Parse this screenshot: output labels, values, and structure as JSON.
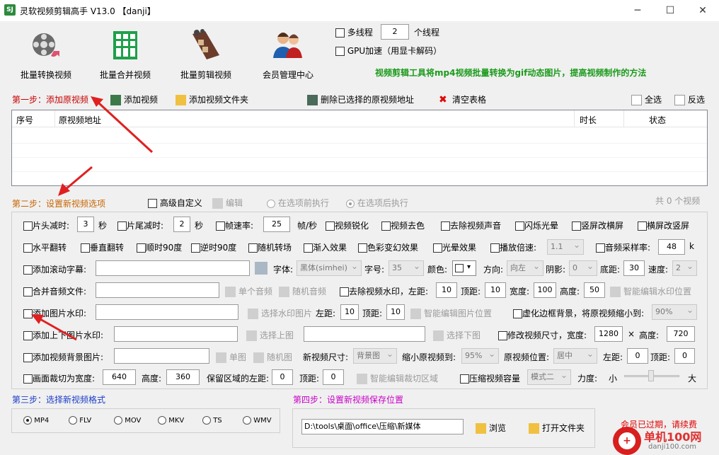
{
  "window": {
    "title": "灵软视频剪辑高手 V13.0 【danji】",
    "app_icon": "app-icon",
    "minimize": "─",
    "maximize": "☐",
    "close": "✕"
  },
  "toolbar": {
    "items": [
      {
        "label": "批量转换视频",
        "icon": "film-reel-icon"
      },
      {
        "label": "批量合并视频",
        "icon": "merge-grid-icon"
      },
      {
        "label": "批量剪辑视频",
        "icon": "film-strip-icon"
      },
      {
        "label": "会员管理中心",
        "icon": "users-icon"
      }
    ]
  },
  "threads": {
    "multithread_label": "多线程",
    "thread_count": "2",
    "thread_unit": "个线程",
    "gpu_label": "GPU加速（用显卡解码）"
  },
  "promo": {
    "text": "视频剪辑工具将mp4视频批量转换为gif动态图片，提高视频制作的方法",
    "color": "#1a9a1a"
  },
  "step1": {
    "title": "第一步：添加原视频",
    "add_video": "添加视频",
    "add_folder": "添加视频文件夹",
    "delete_selected": "删除已选择的原视频地址",
    "clear_table": "清空表格",
    "select_all": "全选",
    "invert": "反选"
  },
  "table": {
    "columns": [
      "序号",
      "原视频地址",
      "时长",
      "状态"
    ]
  },
  "step2": {
    "title": "第二步：设置新视频选项",
    "advanced": "高级自定义",
    "edit": "编辑",
    "before": "在选项前执行",
    "after": "在选项后执行",
    "count_text": "共 0 个视频"
  },
  "row1": {
    "head_cut": "片头减时:",
    "head_val": "3",
    "sec1": "秒",
    "tail_cut": "片尾减时:",
    "tail_val": "2",
    "sec2": "秒",
    "fps": "帧速率:",
    "fps_val": "25",
    "fps_unit": "帧/秒",
    "sharpen": "视频锐化",
    "decolor": "视频去色",
    "remove_audio": "去除视频声音",
    "flash": "闪烁光晕",
    "v2h": "竖屏改横屏",
    "h2v": "横屏改竖屏"
  },
  "row2": {
    "hflip": "水平翻转",
    "vflip": "垂直翻转",
    "cw90": "顺时90度",
    "ccw90": "逆时90度",
    "random_trans": "随机转场",
    "fade_in": "渐入效果",
    "color_fx": "色彩变幻效果",
    "glow": "光晕效果",
    "speed": "播放倍速:",
    "speed_val": "1.1",
    "sample_rate": "音频采样率:",
    "sample_val": "48",
    "sample_unit": "k"
  },
  "row3": {
    "scroll_sub": "添加滚动字幕:",
    "font": "字体:",
    "font_val": "黑体(simhei)",
    "size": "字号:",
    "size_val": "35",
    "color": "颜色:",
    "direction": "方向:",
    "direction_val": "向左",
    "shadow": "阴影:",
    "shadow_val": "0",
    "bottom": "底距:",
    "bottom_val": "30",
    "speed": "速度:",
    "speed_val": "2"
  },
  "row4": {
    "merge_audio": "合并音频文件:",
    "single_audio": "单个音频",
    "random_audio": "随机音频",
    "remove_wm": "去除视频水印，左距:",
    "left_val": "10",
    "top": "顶距:",
    "top_val": "10",
    "width": "宽度:",
    "width_val": "100",
    "height": "高度:",
    "height_val": "50",
    "smart_wm": "智能编辑水印位置"
  },
  "row5": {
    "image_wm": "添加图片水印:",
    "select_wm": "选择水印图片",
    "left": "左距:",
    "left_val": "10",
    "top": "顶距:",
    "top_val": "10",
    "smart_img": "智能编辑图片位置",
    "blur_border": "虚化边框背景，将原视频缩小到:",
    "blur_val": "90%"
  },
  "row6": {
    "topbottom": "添加上下图片水印:",
    "select_top": "选择上图",
    "select_bottom": "选择下图",
    "resize": "修改视频尺寸，宽度:",
    "width_val": "1280",
    "x": "×",
    "height": "高度:",
    "height_val": "720"
  },
  "row7": {
    "bg_image": "添加视频背景图片:",
    "single_img": "单图",
    "random_img": "随机图",
    "new_size": "新视频尺寸:",
    "new_size_val": "背景图",
    "shrink": "缩小原视频到:",
    "shrink_val": "95%",
    "position": "原视频位置:",
    "position_val": "居中",
    "left": "左距:",
    "left_val": "0",
    "top": "顶距:",
    "top_val": "0"
  },
  "row8": {
    "crop": "画面裁切为宽度:",
    "crop_w": "640",
    "height": "高度:",
    "crop_h": "360",
    "keep_left": "保留区域的左距:",
    "keep_left_val": "0",
    "top": "顶距:",
    "top_val": "0",
    "smart_crop": "智能编辑裁切区域",
    "compress": "压缩视频容量",
    "mode_val": "模式二",
    "strength": "力度:",
    "small": "小",
    "big": "大"
  },
  "step3": {
    "title": "第三步：选择新视频格式",
    "formats": [
      "MP4",
      "FLV",
      "MOV",
      "MKV",
      "TS",
      "WMV"
    ]
  },
  "step4": {
    "title": "第四步：设置新视频保存位置",
    "path": "D:\\tools\\桌面\\office\\压缩\\新媒体",
    "browse": "浏览",
    "open_folder": "打开文件夹"
  },
  "member": {
    "expired": "会员已过期，请续费"
  },
  "watermark": {
    "brand": "单机100网",
    "url": "danji100.com"
  }
}
